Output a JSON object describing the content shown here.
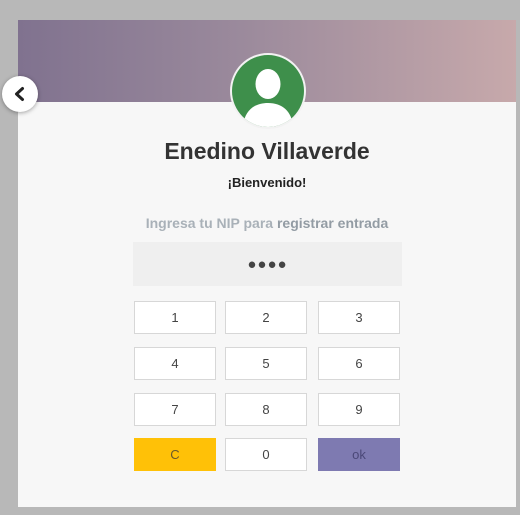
{
  "user": {
    "name": "Enedino Villaverde",
    "greeting": "¡Bienvenido!"
  },
  "prompt": {
    "text": "Ingresa tu NIP para",
    "action": "registrar entrada"
  },
  "pin": {
    "masked_value": "●●●●"
  },
  "keypad": {
    "keys": [
      "1",
      "2",
      "3",
      "4",
      "5",
      "6",
      "7",
      "8",
      "9",
      "C",
      "0",
      "ok"
    ]
  },
  "icons": {
    "back": "chevron-left-icon",
    "avatar": "user-silhouette-icon"
  },
  "colors": {
    "avatar_bg": "#3e8f4b",
    "clear_button": "#ffc107",
    "ok_button": "#7e7ab1"
  }
}
